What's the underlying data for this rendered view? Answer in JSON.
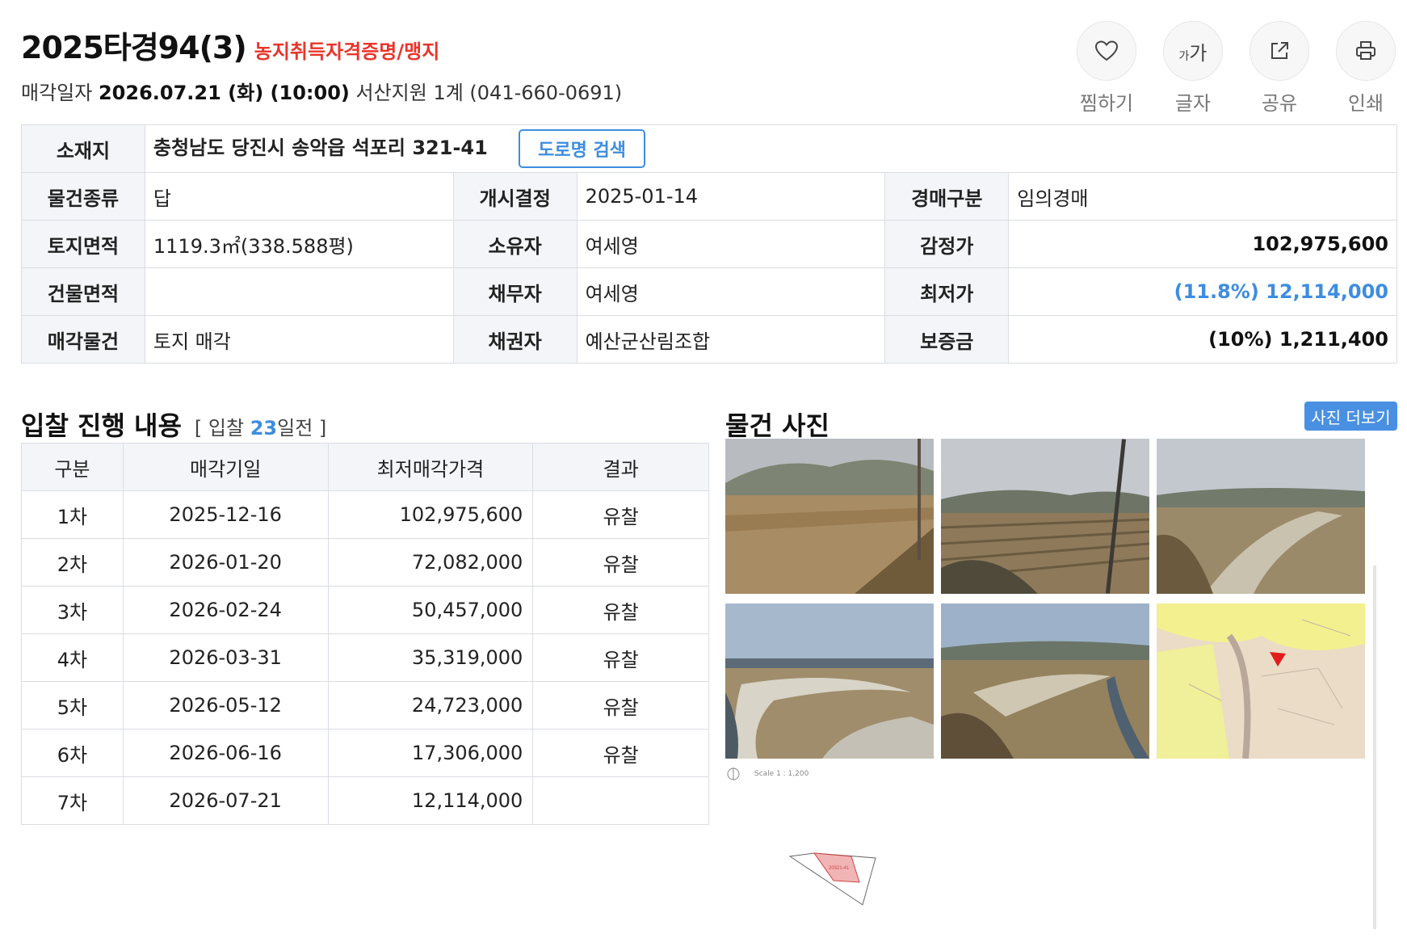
{
  "header": {
    "case_no": "2025타경94(3)",
    "tag": "농지취득자격증명/맹지",
    "sale_prefix": "매각일자",
    "sale_date": "2026.07.21 (화) (10:00)",
    "court": "서산지원 1계 (041-660-0691)"
  },
  "actions": [
    {
      "label": "찜하기",
      "icon": "heart-icon"
    },
    {
      "label": "글자",
      "icon": "font-size-icon",
      "glyph_small": "가",
      "glyph_large": "가"
    },
    {
      "label": "공유",
      "icon": "share-icon"
    },
    {
      "label": "인쇄",
      "icon": "print-icon"
    }
  ],
  "info": {
    "location_label": "소재지",
    "location_value": "충청남도 당진시 송악읍 석포리 321-41",
    "road_search": "도로명 검색",
    "rows": [
      {
        "l1": "물건종류",
        "v1": "답",
        "l2": "개시결정",
        "v2": "2025-01-14",
        "l3": "경매구분",
        "v3": "임의경매"
      },
      {
        "l1": "토지면적",
        "v1": "1119.3㎡(338.588평)",
        "l2": "소유자",
        "v2": "여세영",
        "l3": "감정가",
        "v3": "102,975,600"
      },
      {
        "l1": "건물면적",
        "v1": "",
        "l2": "채무자",
        "v2": "여세영",
        "l3": "최저가",
        "v3": "(11.8%) 12,114,000"
      },
      {
        "l1": "매각물건",
        "v1": "토지 매각",
        "l2": "채권자",
        "v2": "예산군산림조합",
        "l3": "보증금",
        "v3": "(10%) 1,211,400"
      }
    ]
  },
  "bids": {
    "title": "입찰 진행 내용",
    "count_prefix": "[ 입찰",
    "count_days": "23",
    "count_suffix": "일전 ]",
    "columns": [
      "구분",
      "매각기일",
      "최저매각가격",
      "결과"
    ],
    "rows": [
      [
        "1차",
        "2025-12-16",
        "102,975,600",
        "유찰"
      ],
      [
        "2차",
        "2026-01-20",
        "72,082,000",
        "유찰"
      ],
      [
        "3차",
        "2026-02-24",
        "50,457,000",
        "유찰"
      ],
      [
        "4차",
        "2026-03-31",
        "35,319,000",
        "유찰"
      ],
      [
        "5차",
        "2026-05-12",
        "24,723,000",
        "유찰"
      ],
      [
        "6차",
        "2026-06-16",
        "17,306,000",
        "유찰"
      ],
      [
        "7차",
        "2026-07-21",
        "12,114,000",
        ""
      ]
    ]
  },
  "photos": {
    "title": "물건 사진",
    "more": "사진 더보기",
    "scale_text": "Scale 1 : 1,200",
    "parcel_label": "20321-41",
    "colors": {
      "accent": "#4a90e2",
      "sale_tag": "#e8352b",
      "min_price": "#3d8de0"
    }
  }
}
